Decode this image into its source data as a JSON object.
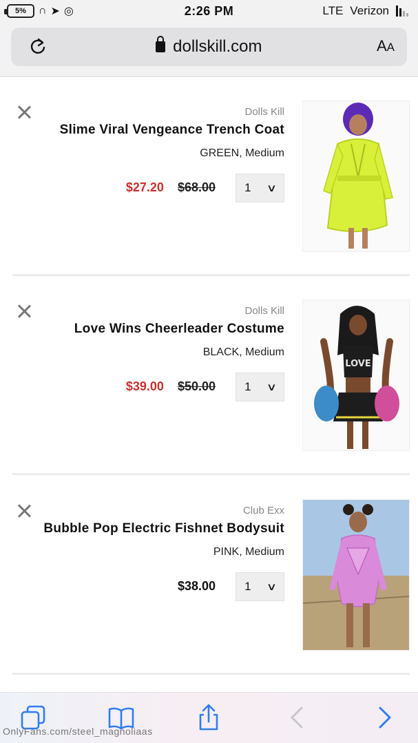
{
  "status_bar": {
    "battery": "5%",
    "time": "2:26 PM",
    "carrier": "Verizon",
    "network": "LTE"
  },
  "browser": {
    "url": "dollskill.com",
    "text_size_label_big": "A",
    "text_size_label_small": "A"
  },
  "cart": {
    "items": [
      {
        "brand": "Dolls Kill",
        "name": "Slime Viral Vengeance Trench Coat",
        "variant": "GREEN, Medium",
        "original_price": "$68.00",
        "sale_price": "$27.20",
        "quantity": "1",
        "image_colors": {
          "main": "#d9f03a",
          "hair": "#5b2bb6",
          "skin": "#b6805f"
        }
      },
      {
        "brand": "Dolls Kill",
        "name": "Love Wins Cheerleader Costume",
        "variant": "BLACK, Medium",
        "original_price": "$50.00",
        "sale_price": "$39.00",
        "quantity": "1",
        "image_colors": {
          "main": "#1d1d1d",
          "hair": "#1a1a1a",
          "skin": "#7a4a2e"
        }
      },
      {
        "brand": "Club Exx",
        "name": "Bubble Pop Electric Fishnet Bodysuit",
        "variant": "PINK, Medium",
        "price": "$38.00",
        "quantity": "1",
        "image_colors": {
          "main": "#d98ad8",
          "hair": "#2a1d16",
          "skin": "#9a6a4c"
        }
      }
    ]
  },
  "toolbar": {
    "icons": [
      "tabs-icon",
      "bookmarks-icon",
      "share-icon",
      "back-icon",
      "forward-icon"
    ]
  },
  "watermark": "OnlyFans.com/steel_magnoliaas",
  "colors": {
    "sale_price": "#c8312f",
    "link_blue": "#2f7cf6"
  }
}
